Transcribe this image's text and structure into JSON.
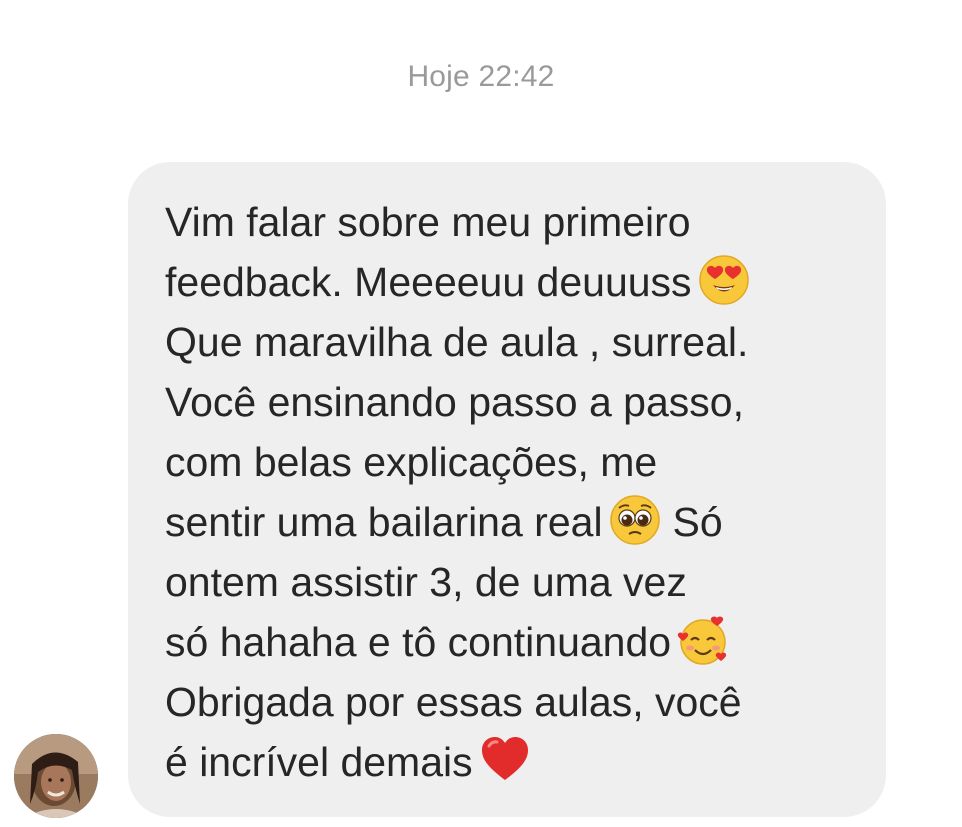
{
  "thread": {
    "timestamp": "Hoje 22:42"
  },
  "message": {
    "lines": [
      "Vim falar sobre meu primeiro",
      "feedback. Meeeeuu deuuuss",
      "Que maravilha de aula , surreal.",
      "Você ensinando passo a passo,",
      "com belas explicações, me",
      "sentir uma bailarina real",
      "Só",
      "ontem assistir 3, de uma vez",
      "só hahaha e tô continuando",
      "Obrigada por essas aulas, você",
      "é incrível demais"
    ],
    "emojis": [
      "heart-eyes-emoji",
      "pleading-face-emoji",
      "smiling-face-with-hearts-emoji",
      "red-heart-emoji"
    ],
    "bubble_color": "#efefef",
    "text_color": "#262626"
  },
  "sender": {
    "avatar_icon": "avatar"
  }
}
